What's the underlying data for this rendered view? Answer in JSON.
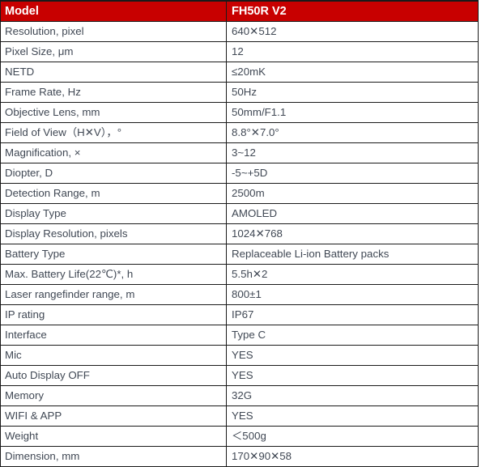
{
  "table": {
    "title_column_header": "Model",
    "value_column_header": "FH50R V2",
    "header_bg_color": "#c80000",
    "header_text_color": "#ffffff",
    "body_text_color": "#404854",
    "border_color": "#1a1a1a",
    "rows": [
      {
        "label": "Resolution, pixel",
        "value": "640✕512"
      },
      {
        "label": "Pixel Size, μm",
        "value": "12"
      },
      {
        "label": "NETD",
        "value": "≤20mK"
      },
      {
        "label": "Frame Rate, Hz",
        "value": "50Hz"
      },
      {
        "label": "Objective Lens, mm",
        "value": "50mm/F1.1"
      },
      {
        "label": "Field of View（H✕V），°",
        "value": "8.8°✕7.0°"
      },
      {
        "label": "Magnification, ×",
        "value": "3~12"
      },
      {
        "label": "Diopter, D",
        "value": "-5~+5D"
      },
      {
        "label": "Detection Range, m",
        "value": "2500m"
      },
      {
        "label": "Display Type",
        "value": "AMOLED"
      },
      {
        "label": "Display Resolution, pixels",
        "value": "1024✕768"
      },
      {
        "label": "Battery Type",
        "value": "Replaceable Li-ion Battery packs"
      },
      {
        "label": "Max. Battery Life(22℃)*, h",
        "value": "5.5h✕2"
      },
      {
        "label": "Laser rangefinder range, m",
        "value": "800±1"
      },
      {
        "label": "IP rating",
        "value": "IP67"
      },
      {
        "label": "Interface",
        "value": "Type C"
      },
      {
        "label": "Mic",
        "value": "YES"
      },
      {
        "label": "Auto Display OFF",
        "value": "YES"
      },
      {
        "label": "Memory",
        "value": "32G"
      },
      {
        "label": "WIFI & APP",
        "value": "YES"
      },
      {
        "label": "Weight",
        "value": "＜500g"
      },
      {
        "label": "Dimension, mm",
        "value": "170✕90✕58"
      }
    ]
  }
}
